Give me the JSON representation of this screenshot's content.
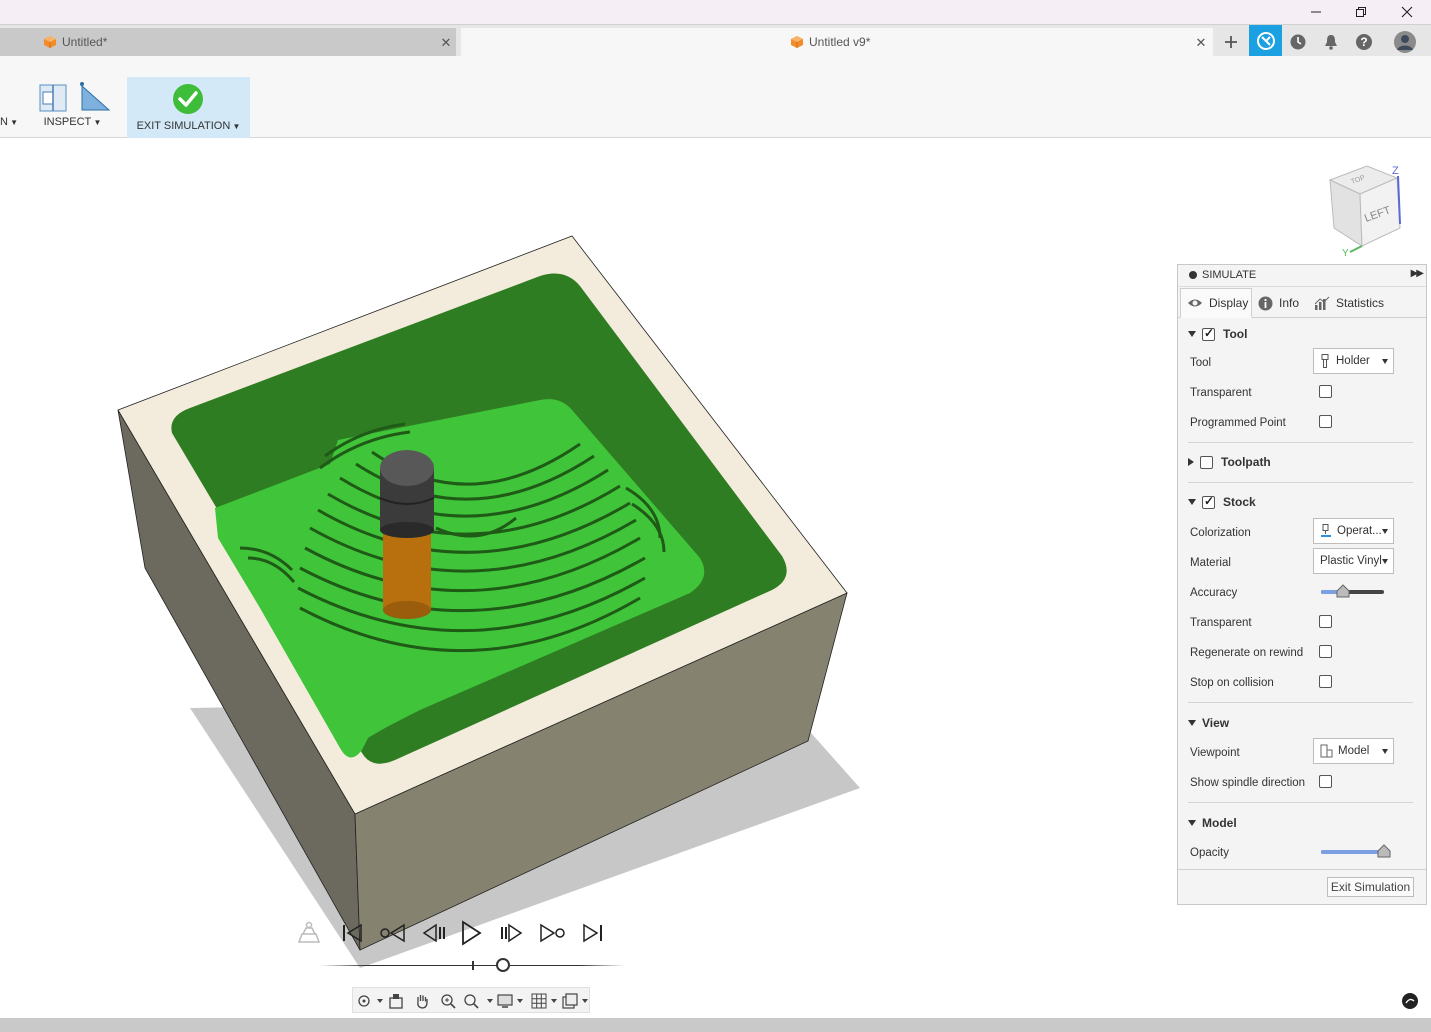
{
  "window": {
    "controls": [
      "minimize",
      "restore",
      "close"
    ]
  },
  "tabs": [
    {
      "label": "Untitled*",
      "active": false
    },
    {
      "label": "Untitled v9*",
      "active": true
    }
  ],
  "toolbar": {
    "partial_label": "N",
    "inspect_label": "INSPECT",
    "exit_label": "EXIT SIMULATION"
  },
  "viewcube": {
    "face": "LEFT",
    "top_face": "TOP",
    "axis_z": "Z",
    "axis_y": "Y"
  },
  "simulate": {
    "title": "SIMULATE",
    "tabs": {
      "display": "Display",
      "info": "Info",
      "statistics": "Statistics"
    },
    "tool_section": {
      "title": "Tool",
      "checked": true,
      "tool_label": "Tool",
      "tool_value": "Holder",
      "transparent_label": "Transparent",
      "transparent": false,
      "programmed_point_label": "Programmed Point",
      "programmed_point": false
    },
    "toolpath_section": {
      "title": "Toolpath",
      "checked": false
    },
    "stock_section": {
      "title": "Stock",
      "checked": true,
      "colorization_label": "Colorization",
      "colorization_value": "Operat...",
      "material_label": "Material",
      "material_value": "Plastic Vinyl",
      "accuracy_label": "Accuracy",
      "accuracy_level": 0.35,
      "transparent_label": "Transparent",
      "transparent": false,
      "regenerate_label": "Regenerate on rewind",
      "regenerate": false,
      "stop_label": "Stop on collision",
      "stop": false
    },
    "view_section": {
      "title": "View",
      "viewpoint_label": "Viewpoint",
      "viewpoint_value": "Model",
      "spindle_label": "Show spindle direction",
      "spindle": false
    },
    "model_section": {
      "title": "Model",
      "opacity_label": "Opacity",
      "opacity_level": 1.0
    },
    "exit_button": "Exit Simulation"
  },
  "playback": {
    "progress": 0.6
  },
  "colors": {
    "accent": "#1ba1e2",
    "stock_green": "#3fc43a",
    "wall_green": "#2e7d1f",
    "stock_body": "#7a776a",
    "stock_top": "#f3ecdc",
    "tool_holder": "#3b3b3b",
    "tool_shank": "#b8700f"
  }
}
